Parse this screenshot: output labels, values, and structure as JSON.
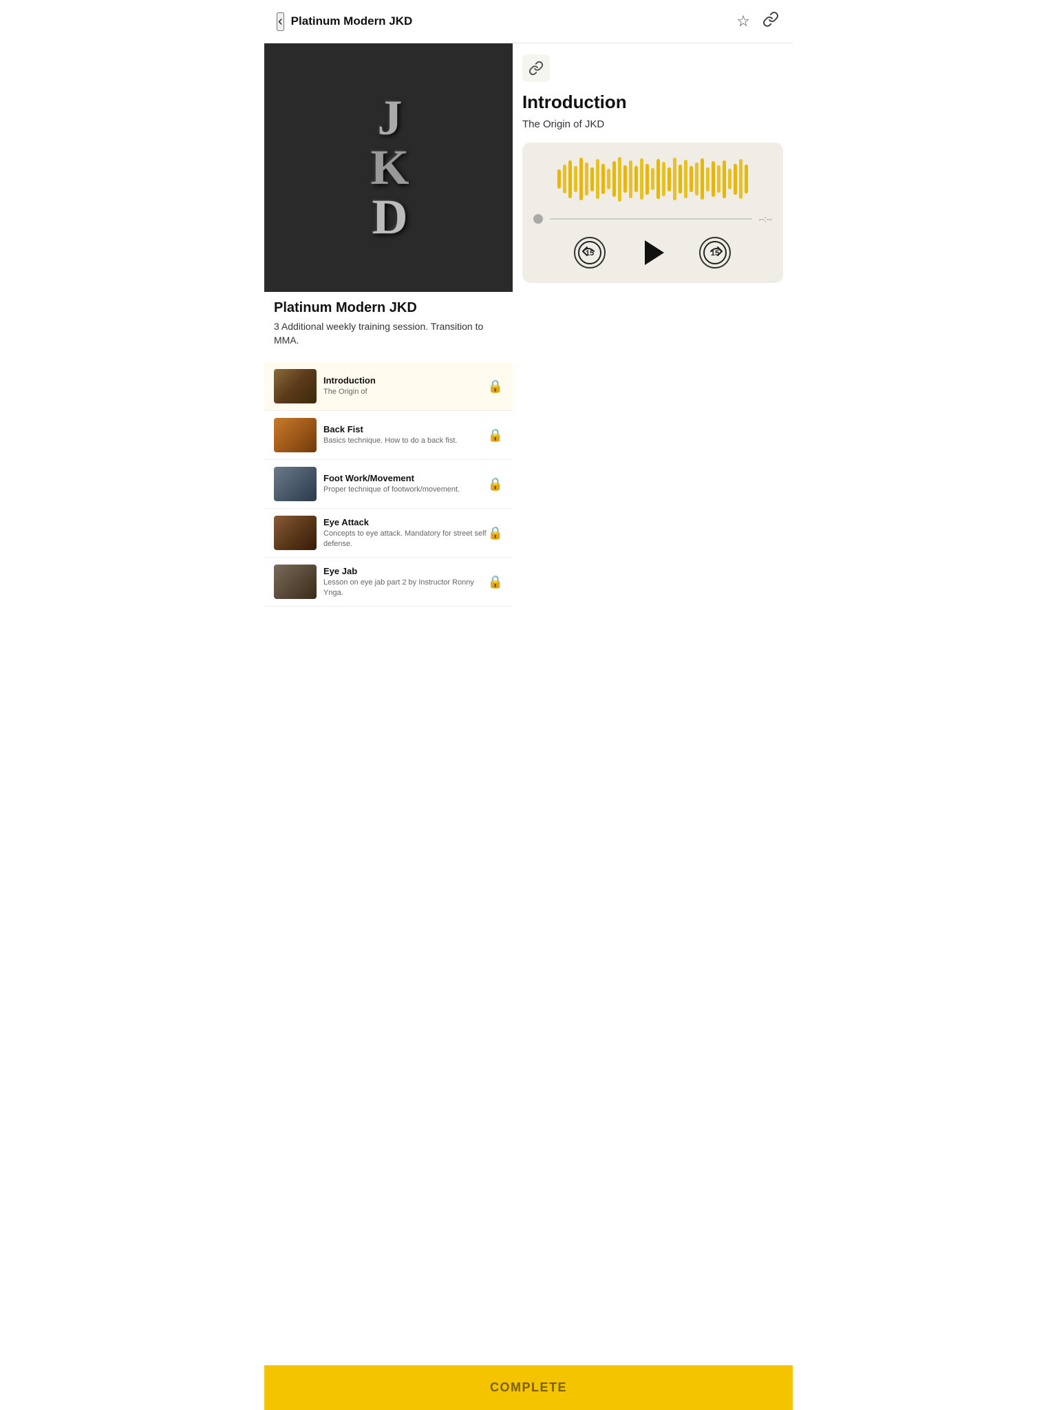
{
  "header": {
    "title": "Platinum Modern JKD",
    "back_label": "‹",
    "star_icon": "☆",
    "link_icon": "🔗"
  },
  "course": {
    "title": "Platinum Modern JKD",
    "description": "3 Additional weekly training session. Transition to MMA.",
    "image_alt": "JKD Logo"
  },
  "lessons": [
    {
      "name": "Introduction",
      "sub": "The Origin of",
      "locked": true,
      "active": true,
      "thumb_class": "thumb-martial"
    },
    {
      "name": "Back Fist",
      "sub": "Basics technique. How to do a back fist.",
      "locked": true,
      "active": false,
      "thumb_class": "thumb-fight1"
    },
    {
      "name": "Foot Work/Movement",
      "sub": "Proper technique of footwork/movement.",
      "locked": true,
      "active": false,
      "thumb_class": "thumb-fight2"
    },
    {
      "name": "Eye Attack",
      "sub": "Concepts to eye attack. Mandatory for street self defense.",
      "locked": true,
      "active": false,
      "thumb_class": "thumb-fight3"
    },
    {
      "name": "Eye Jab",
      "sub": "Lesson on eye jab part 2 by Instructor Ronny Ynga.",
      "locked": true,
      "active": false,
      "thumb_class": "thumb-fight4"
    }
  ],
  "current_lesson": {
    "title": "Introduction",
    "subtitle": "The Origin of JKD"
  },
  "audio_player": {
    "progress_time": "--:--",
    "rewind_label": "15",
    "forward_label": "15",
    "play_label": "Play"
  },
  "complete_button": {
    "label": "COMPLETE"
  },
  "waveform_bars": [
    28,
    42,
    55,
    38,
    62,
    48,
    35,
    58,
    44,
    30,
    52,
    65,
    40,
    55,
    38,
    60,
    45,
    32,
    58,
    50,
    35,
    62,
    42,
    56,
    38,
    48,
    60,
    35,
    52,
    40,
    55,
    30,
    45,
    58,
    42
  ]
}
